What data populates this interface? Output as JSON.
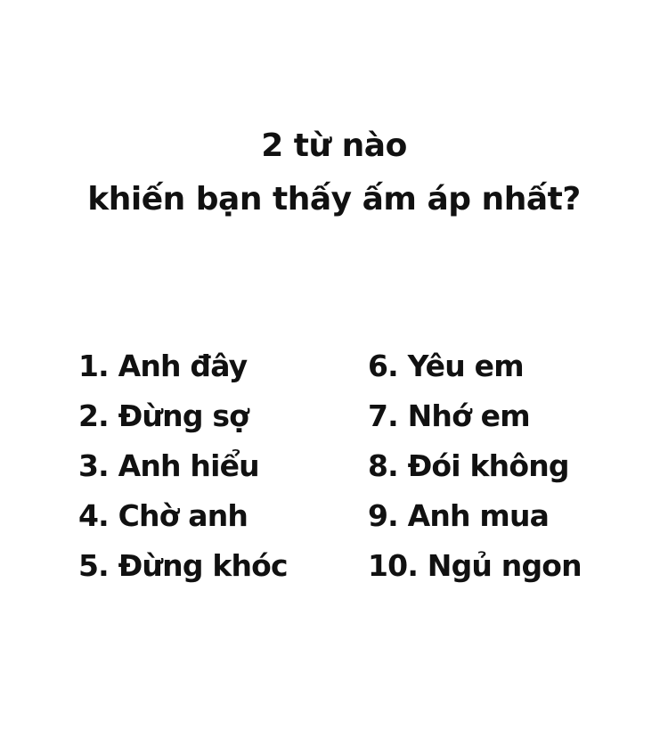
{
  "title": {
    "line1": "2 từ nào",
    "line2": "khiến bạn thấy ấm áp nhất?"
  },
  "list": {
    "left": [
      "1. Anh đây",
      "2. Đừng sợ",
      "3. Anh hiểu",
      "4. Chờ anh",
      "5. Đừng khóc"
    ],
    "right": [
      "6. Yêu em",
      "7. Nhớ em",
      "8. Đói không",
      "9. Anh mua",
      "10. Ngủ ngon"
    ]
  },
  "colors": {
    "background": "#ffffff",
    "text": "#111111"
  }
}
